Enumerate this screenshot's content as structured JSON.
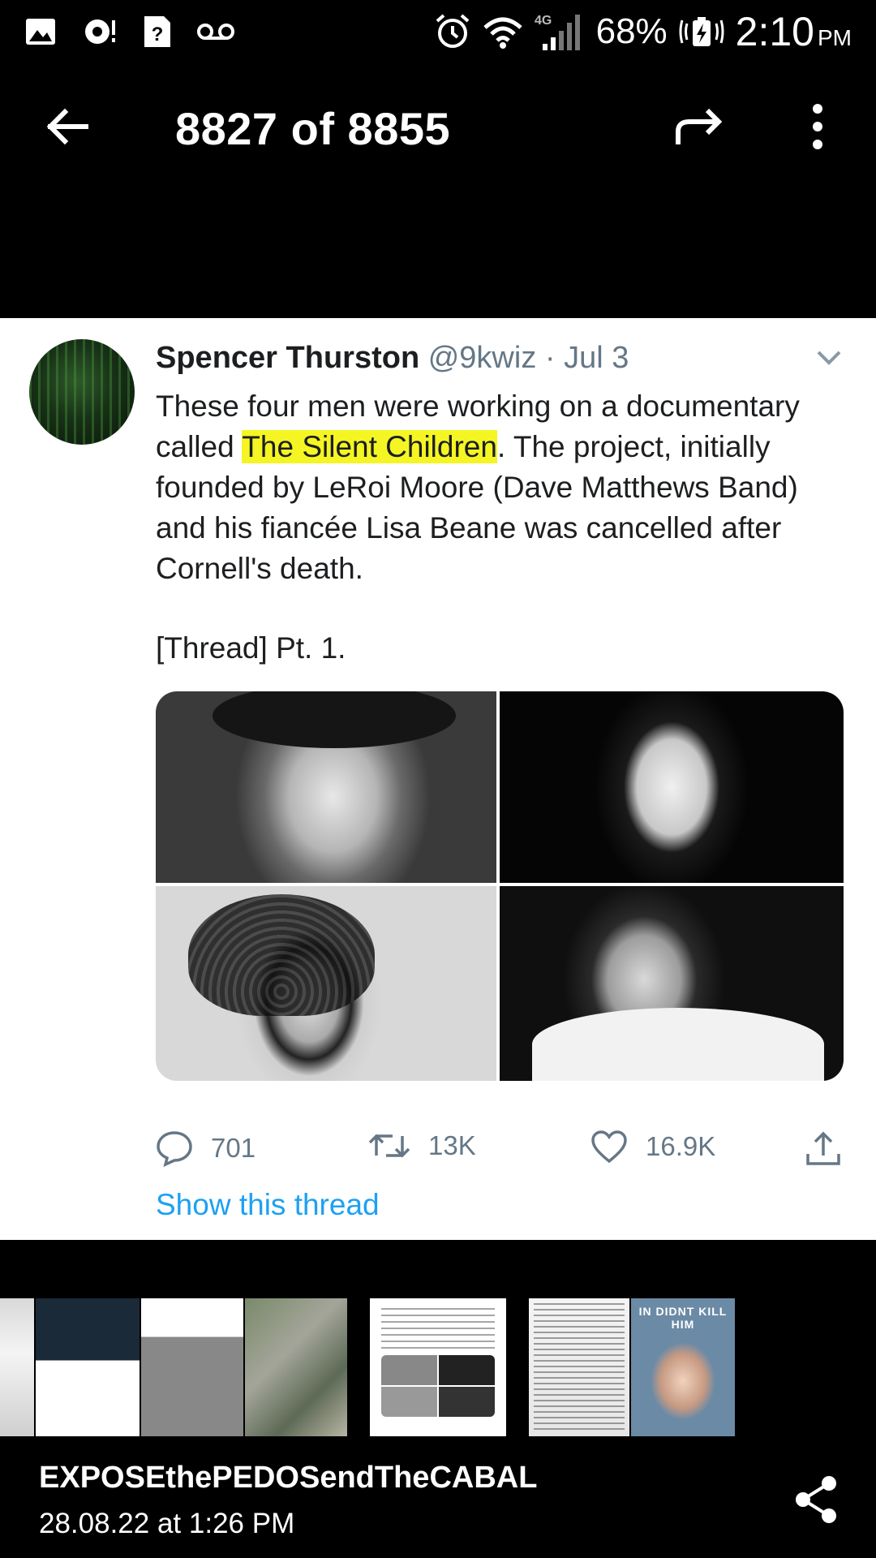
{
  "status_bar": {
    "network": "4G",
    "battery": "68%",
    "time": "2:10",
    "ampm": "PM",
    "icons": [
      "image-icon",
      "sync-icon",
      "help-icon",
      "voicemail-icon",
      "alarm-icon",
      "wifi-icon",
      "signal-icon",
      "battery-charging-icon"
    ]
  },
  "toolbar": {
    "counter": "8827 of 8855",
    "icons": [
      "back-arrow-icon",
      "forward-share-icon",
      "more-vert-icon"
    ]
  },
  "tweet": {
    "name": "Spencer Thurston",
    "handle": "@9kwiz",
    "separator": "·",
    "date": "Jul 3",
    "body_before": "These four men were working on a documentary called ",
    "body_highlight": "The Silent Children",
    "body_after": ". The project, initially founded by LeRoi Moore (Dave Matthews Band) and his fiancée Lisa Beane was cancelled after Cornell's death.",
    "thread_label": "[Thread] Pt. 1.",
    "replies": "701",
    "retweets": "13K",
    "likes": "16.9K",
    "show_thread": "Show this thread",
    "highlight_color": "#f5f524",
    "link_color": "#1da1f2"
  },
  "thumbnails": {
    "last_banner": "IN DIDNT KILL HIM"
  },
  "footer": {
    "chat_name": "EXPOSEthePEDOSendTheCABAL",
    "timestamp": "28.08.22 at 1:26 PM"
  }
}
